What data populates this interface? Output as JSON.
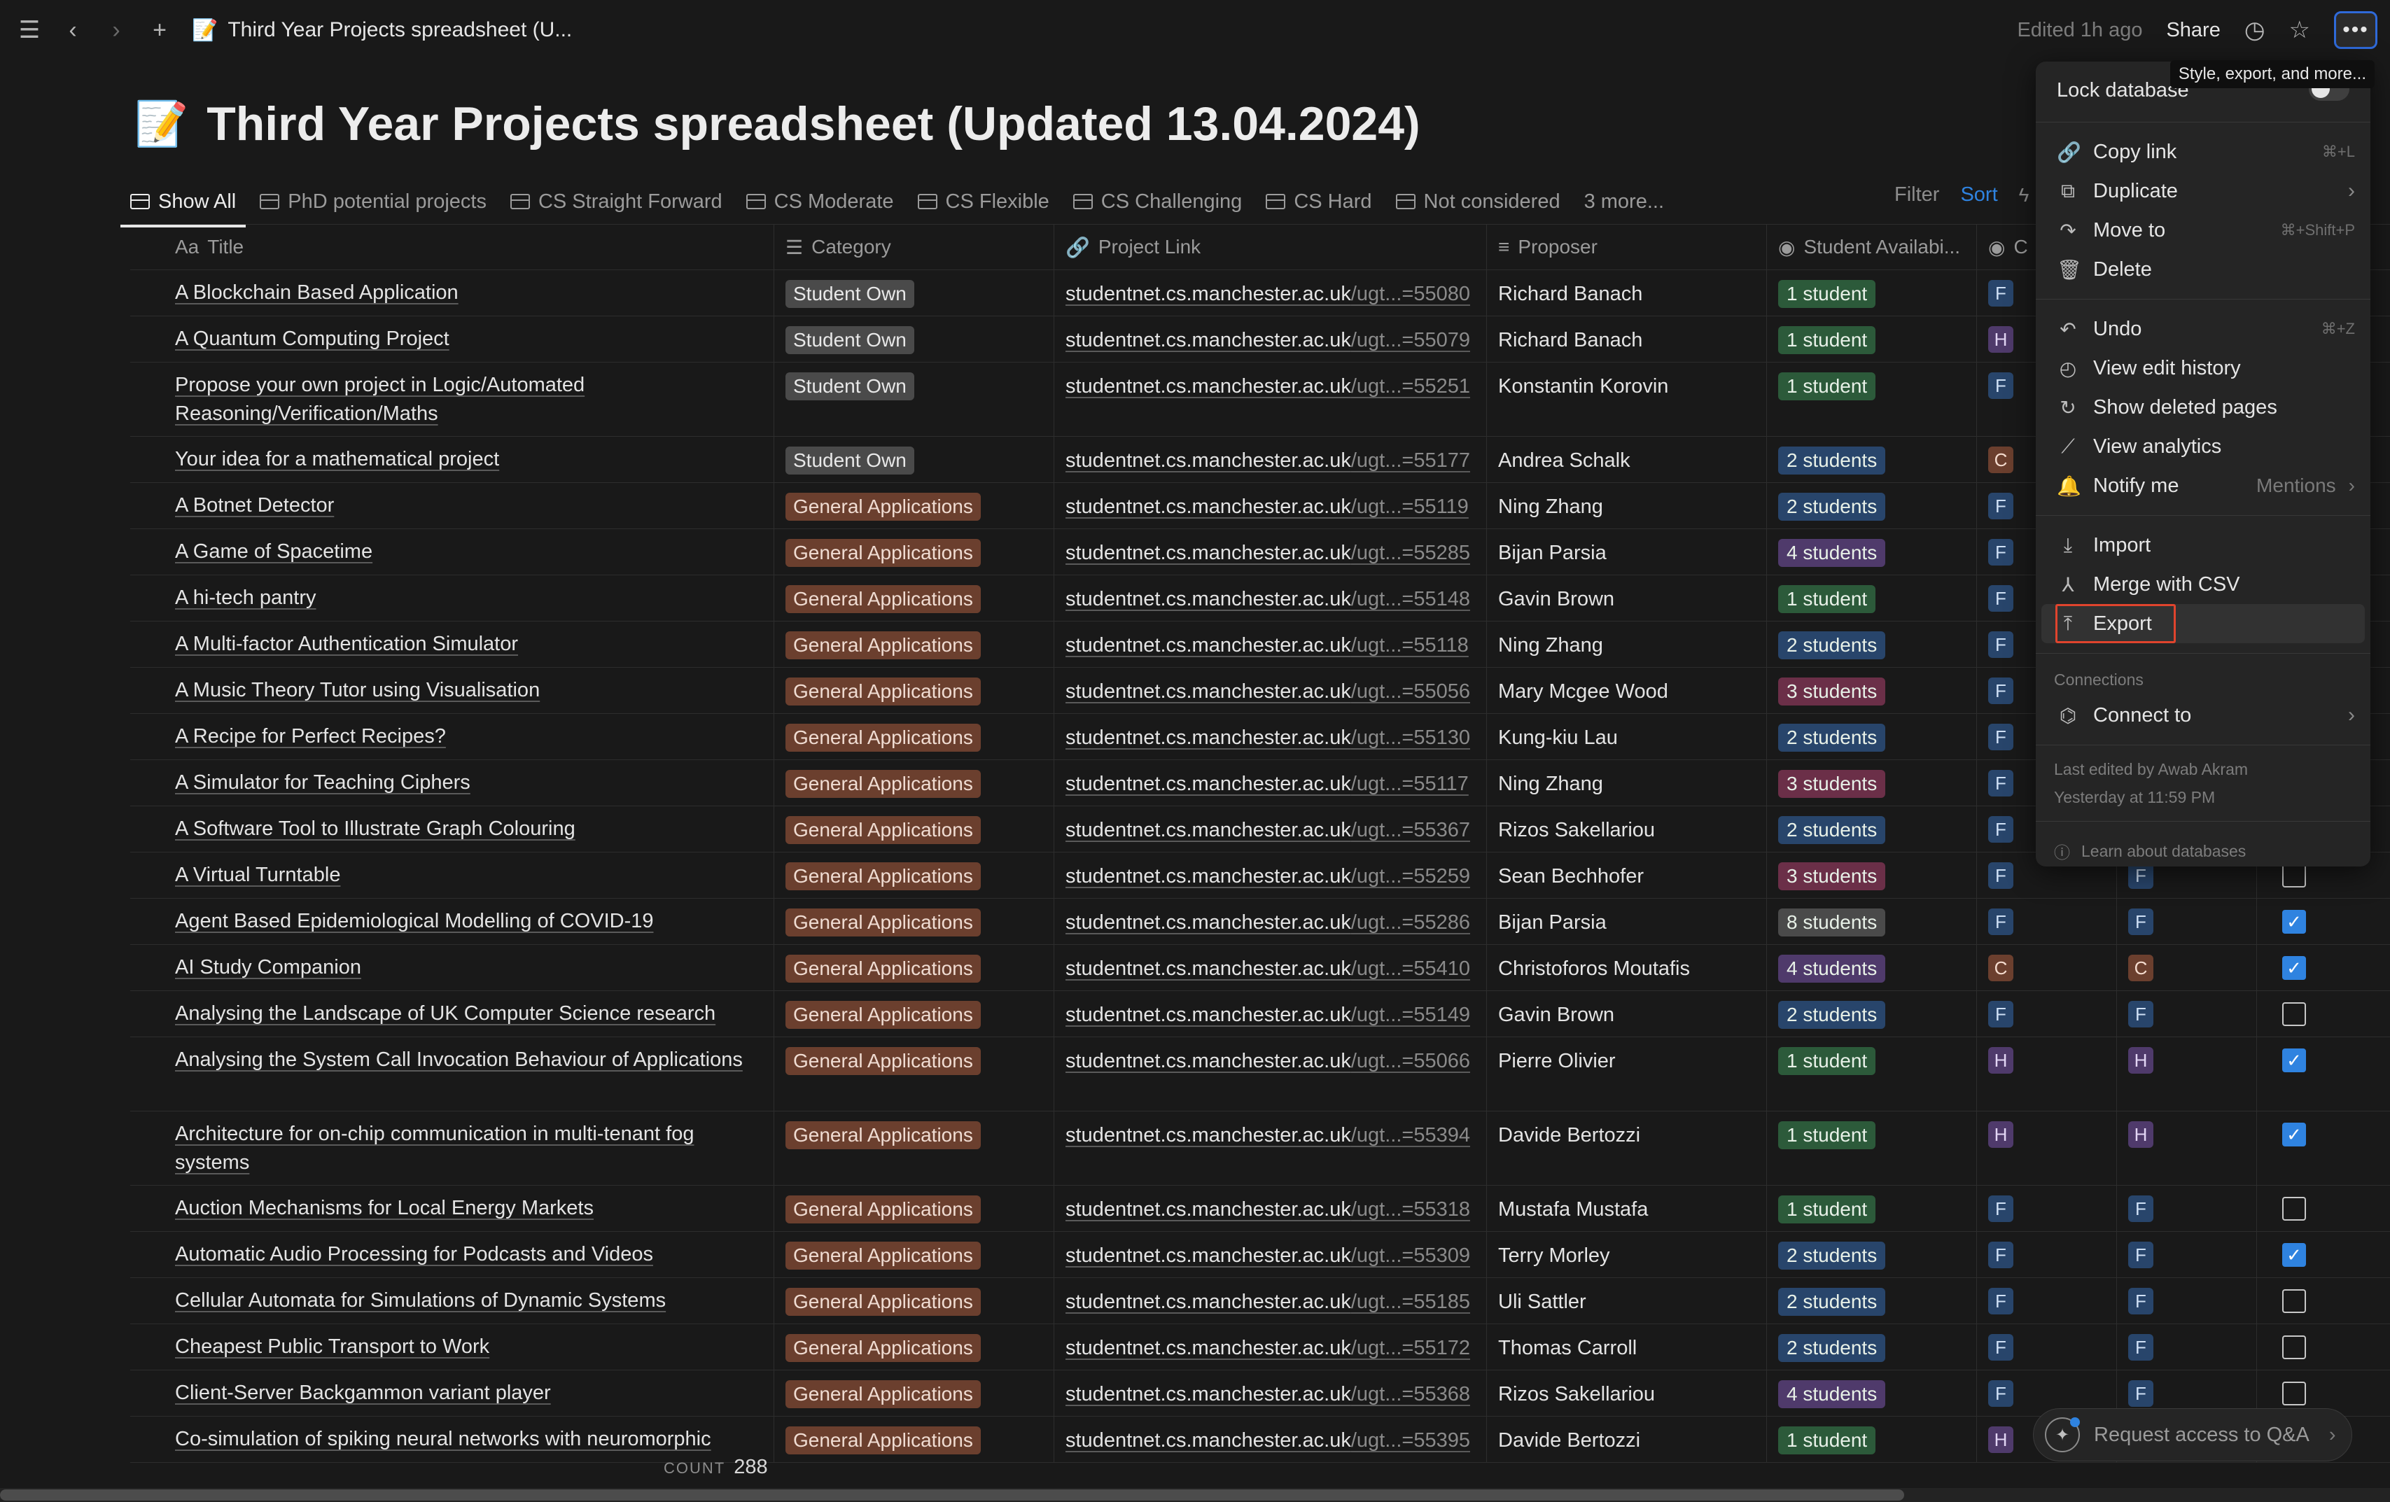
{
  "topbar": {
    "breadcrumb": "Third Year Projects spreadsheet (U...",
    "edited": "Edited 1h ago",
    "share": "Share",
    "tooltip": "Style, export, and more..."
  },
  "page": {
    "emoji": "📝",
    "title": "Third Year Projects spreadsheet (Updated 13.04.2024)"
  },
  "tabs": [
    {
      "label": "Show All"
    },
    {
      "label": "PhD potential projects"
    },
    {
      "label": "CS Straight Forward"
    },
    {
      "label": "CS Moderate"
    },
    {
      "label": "CS Flexible"
    },
    {
      "label": "CS Challenging"
    },
    {
      "label": "CS Hard"
    },
    {
      "label": "Not considered"
    },
    {
      "label": "3 more..."
    }
  ],
  "toolbar": {
    "filter": "Filter",
    "sort": "Sort"
  },
  "columns": {
    "title": "Title",
    "title_prefix": "Aa",
    "category": "Category",
    "link": "Project Link",
    "proposer": "Proposer",
    "availability": "Student Availabi...",
    "col6": "C"
  },
  "rows": [
    {
      "title": "A Blockchain Based Application",
      "category": "Student Own",
      "link_base": "studentnet.cs.manchester.ac.uk",
      "link_tail": "/ugt...=55080",
      "proposer": "Richard Banach",
      "avail": "1 student",
      "f1": "F",
      "f2": "",
      "chk": null
    },
    {
      "title": "A Quantum Computing Project",
      "category": "Student Own",
      "link_base": "studentnet.cs.manchester.ac.uk",
      "link_tail": "/ugt...=55079",
      "proposer": "Richard Banach",
      "avail": "1 student",
      "f1": "H",
      "f2": "",
      "chk": null
    },
    {
      "title": "Propose your own project in Logic/Automated Reasoning/Verification/Maths",
      "category": "Student Own",
      "link_base": "studentnet.cs.manchester.ac.uk",
      "link_tail": "/ugt...=55251",
      "proposer": "Konstantin Korovin",
      "avail": "1 student",
      "f1": "F",
      "f2": "",
      "chk": null,
      "tall": true
    },
    {
      "title": "Your idea for a mathematical project",
      "category": "Student Own",
      "link_base": "studentnet.cs.manchester.ac.uk",
      "link_tail": "/ugt...=55177",
      "proposer": "Andrea Schalk",
      "avail": "2 students",
      "f1": "C",
      "f2": "",
      "chk": null
    },
    {
      "title": "A Botnet Detector",
      "category": "General Applications",
      "link_base": "studentnet.cs.manchester.ac.uk",
      "link_tail": "/ugt...=55119",
      "proposer": "Ning Zhang",
      "avail": "2 students",
      "f1": "F",
      "f2": "",
      "chk": null
    },
    {
      "title": "A Game of Spacetime",
      "category": "General Applications",
      "link_base": "studentnet.cs.manchester.ac.uk",
      "link_tail": "/ugt...=55285",
      "proposer": "Bijan Parsia",
      "avail": "4 students",
      "f1": "F",
      "f2": "",
      "chk": null
    },
    {
      "title": "A hi-tech pantry",
      "category": "General Applications",
      "link_base": "studentnet.cs.manchester.ac.uk",
      "link_tail": "/ugt...=55148",
      "proposer": "Gavin Brown",
      "avail": "1 student",
      "f1": "F",
      "f2": "",
      "chk": null
    },
    {
      "title": "A Multi-factor Authentication Simulator",
      "category": "General Applications",
      "link_base": "studentnet.cs.manchester.ac.uk",
      "link_tail": "/ugt...=55118",
      "proposer": "Ning Zhang",
      "avail": "2 students",
      "f1": "F",
      "f2": "",
      "chk": null
    },
    {
      "title": "A Music Theory Tutor using Visualisation",
      "category": "General Applications",
      "link_base": "studentnet.cs.manchester.ac.uk",
      "link_tail": "/ugt...=55056",
      "proposer": "Mary Mcgee Wood",
      "avail": "3 students",
      "f1": "F",
      "f2": "",
      "chk": null
    },
    {
      "title": "A Recipe for Perfect Recipes?",
      "category": "General Applications",
      "link_base": "studentnet.cs.manchester.ac.uk",
      "link_tail": "/ugt...=55130",
      "proposer": "Kung-kiu Lau",
      "avail": "2 students",
      "f1": "F",
      "f2": "",
      "chk": null
    },
    {
      "title": "A Simulator for Teaching Ciphers",
      "category": "General Applications",
      "link_base": "studentnet.cs.manchester.ac.uk",
      "link_tail": "/ugt...=55117",
      "proposer": "Ning Zhang",
      "avail": "3 students",
      "f1": "F",
      "f2": "",
      "chk": null
    },
    {
      "title": "A Software Tool to Illustrate Graph Colouring",
      "category": "General Applications",
      "link_base": "studentnet.cs.manchester.ac.uk",
      "link_tail": "/ugt...=55367",
      "proposer": "Rizos Sakellariou",
      "avail": "2 students",
      "f1": "F",
      "f2": "",
      "chk": null
    },
    {
      "title": "A Virtual Turntable",
      "category": "General Applications",
      "link_base": "studentnet.cs.manchester.ac.uk",
      "link_tail": "/ugt...=55259",
      "proposer": "Sean Bechhofer",
      "avail": "3 students",
      "f1": "F",
      "f2": "F",
      "chk": false
    },
    {
      "title": "Agent Based Epidemiological Modelling of COVID-19",
      "category": "General Applications",
      "link_base": "studentnet.cs.manchester.ac.uk",
      "link_tail": "/ugt...=55286",
      "proposer": "Bijan Parsia",
      "avail": "8 students",
      "f1": "F",
      "f2": "F",
      "chk": true
    },
    {
      "title": "AI Study Companion",
      "category": "General Applications",
      "link_base": "studentnet.cs.manchester.ac.uk",
      "link_tail": "/ugt...=55410",
      "proposer": "Christoforos Moutafis",
      "avail": "4 students",
      "f1": "C",
      "f2": "C",
      "chk": true
    },
    {
      "title": "Analysing the Landscape of UK Computer Science research",
      "category": "General Applications",
      "link_base": "studentnet.cs.manchester.ac.uk",
      "link_tail": "/ugt...=55149",
      "proposer": "Gavin Brown",
      "avail": "2 students",
      "f1": "F",
      "f2": "F",
      "chk": false
    },
    {
      "title": "Analysing the System Call Invocation Behaviour of Applications",
      "category": "General Applications",
      "link_base": "studentnet.cs.manchester.ac.uk",
      "link_tail": "/ugt...=55066",
      "proposer": "Pierre Olivier",
      "avail": "1 student",
      "f1": "H",
      "f2": "H",
      "chk": true,
      "tall": true
    },
    {
      "title": "Architecture for on-chip communication in multi-tenant fog systems",
      "category": "General Applications",
      "link_base": "studentnet.cs.manchester.ac.uk",
      "link_tail": "/ugt...=55394",
      "proposer": "Davide Bertozzi",
      "avail": "1 student",
      "f1": "H",
      "f2": "H",
      "chk": true,
      "tall": true
    },
    {
      "title": "Auction Mechanisms for Local Energy Markets",
      "category": "General Applications",
      "link_base": "studentnet.cs.manchester.ac.uk",
      "link_tail": "/ugt...=55318",
      "proposer": "Mustafa Mustafa",
      "avail": "1 student",
      "f1": "F",
      "f2": "F",
      "chk": false
    },
    {
      "title": "Automatic Audio Processing for Podcasts and Videos",
      "category": "General Applications",
      "link_base": "studentnet.cs.manchester.ac.uk",
      "link_tail": "/ugt...=55309",
      "proposer": "Terry Morley",
      "avail": "2 students",
      "f1": "F",
      "f2": "F",
      "chk": true
    },
    {
      "title": "Cellular Automata for Simulations of Dynamic Systems",
      "category": "General Applications",
      "link_base": "studentnet.cs.manchester.ac.uk",
      "link_tail": "/ugt...=55185",
      "proposer": "Uli Sattler",
      "avail": "2 students",
      "f1": "F",
      "f2": "F",
      "chk": false
    },
    {
      "title": "Cheapest Public Transport to Work",
      "category": "General Applications",
      "link_base": "studentnet.cs.manchester.ac.uk",
      "link_tail": "/ugt...=55172",
      "proposer": "Thomas Carroll",
      "avail": "2 students",
      "f1": "F",
      "f2": "F",
      "chk": false
    },
    {
      "title": "Client-Server Backgammon variant player",
      "category": "General Applications",
      "link_base": "studentnet.cs.manchester.ac.uk",
      "link_tail": "/ugt...=55368",
      "proposer": "Rizos Sakellariou",
      "avail": "4 students",
      "f1": "F",
      "f2": "F",
      "chk": false
    },
    {
      "title": "Co-simulation of spiking neural networks with neuromorphic",
      "category": "General Applications",
      "link_base": "studentnet.cs.manchester.ac.uk",
      "link_tail": "/ugt...=55395",
      "proposer": "Davide Bertozzi",
      "avail": "1 student",
      "f1": "H",
      "f2": "",
      "chk": null
    }
  ],
  "footer": {
    "count_label": "COUNT",
    "count_value": "288",
    "qa": "Request access to Q&A"
  },
  "menu": {
    "lock": "Lock database",
    "items": [
      {
        "label": "Copy link",
        "icon": "link-icon",
        "glyph": "🔗",
        "shortcut": "⌘+L"
      },
      {
        "label": "Duplicate",
        "icon": "duplicate-icon",
        "glyph": "⧉",
        "chevron": true
      },
      {
        "label": "Move to",
        "icon": "move-icon",
        "glyph": "↷",
        "shortcut": "⌘+Shift+P"
      },
      {
        "label": "Delete",
        "icon": "trash-icon",
        "glyph": "🗑"
      },
      {
        "label": "Undo",
        "icon": "undo-icon",
        "glyph": "↶",
        "shortcut": "⌘+Z",
        "sep_before": true
      },
      {
        "label": "View edit history",
        "icon": "history-icon",
        "glyph": "◴"
      },
      {
        "label": "Show deleted pages",
        "icon": "restore-icon",
        "glyph": "↻"
      },
      {
        "label": "View analytics",
        "icon": "analytics-icon",
        "glyph": "⟋"
      },
      {
        "label": "Notify me",
        "icon": "bell-icon",
        "glyph": "🔔",
        "sub": "Mentions",
        "chevron": true
      },
      {
        "label": "Import",
        "icon": "import-icon",
        "glyph": "⤓",
        "sep_before": true
      },
      {
        "label": "Merge with CSV",
        "icon": "merge-icon",
        "glyph": "⅄"
      },
      {
        "label": "Export",
        "icon": "export-icon",
        "glyph": "⤒",
        "highlight": true
      }
    ],
    "connections_header": "Connections",
    "connect": "Connect to",
    "last_edited_line1": "Last edited by Awab Akram",
    "last_edited_line2": "Yesterday at 11:59 PM",
    "learn": "Learn about databases"
  },
  "colors": {
    "accent": "#2f83e0",
    "highlight": "#e0442d",
    "tag_general": "#6b3f2e"
  }
}
